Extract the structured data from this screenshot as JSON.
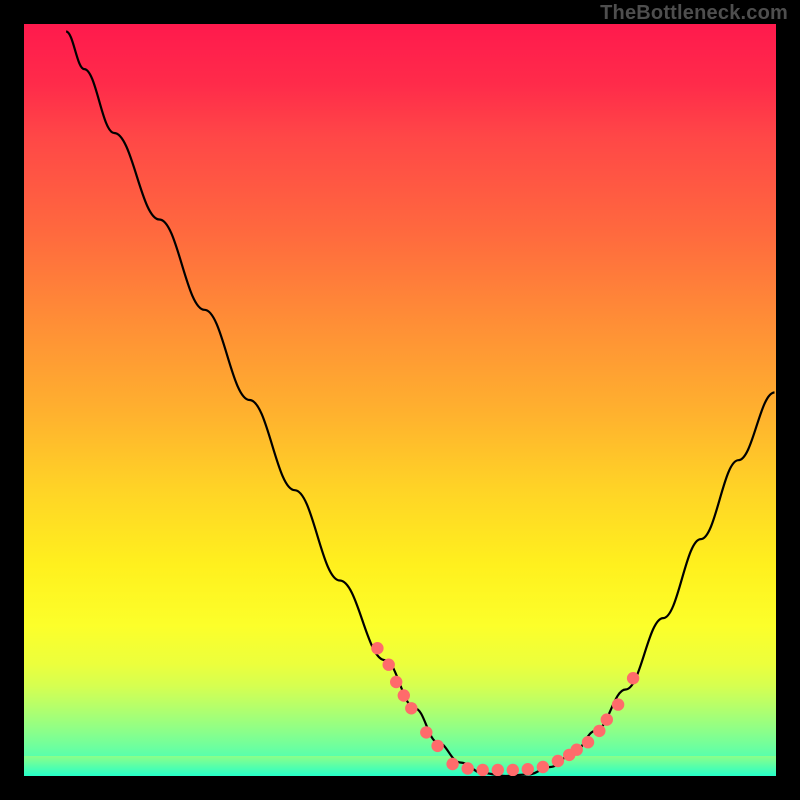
{
  "watermark": "TheBottleneck.com",
  "colors": {
    "dot": "#ff6b6b",
    "line": "#000000"
  },
  "chart_data": {
    "type": "line",
    "title": "",
    "xlabel": "",
    "ylabel": "",
    "xlim": [
      0,
      100
    ],
    "ylim": [
      0,
      100
    ],
    "curve": [
      {
        "x": 5.6,
        "y": 99.0
      },
      {
        "x": 8.0,
        "y": 94.0
      },
      {
        "x": 12.0,
        "y": 85.5
      },
      {
        "x": 18.0,
        "y": 74.0
      },
      {
        "x": 24.0,
        "y": 62.0
      },
      {
        "x": 30.0,
        "y": 50.0
      },
      {
        "x": 36.0,
        "y": 38.0
      },
      {
        "x": 42.0,
        "y": 26.0
      },
      {
        "x": 48.0,
        "y": 15.4
      },
      {
        "x": 52.0,
        "y": 9.0
      },
      {
        "x": 55.0,
        "y": 4.5
      },
      {
        "x": 58.0,
        "y": 1.8
      },
      {
        "x": 61.0,
        "y": 0.4
      },
      {
        "x": 64.0,
        "y": 0.0
      },
      {
        "x": 67.0,
        "y": 0.2
      },
      {
        "x": 70.0,
        "y": 1.2
      },
      {
        "x": 73.0,
        "y": 3.0
      },
      {
        "x": 76.0,
        "y": 6.0
      },
      {
        "x": 80.0,
        "y": 11.5
      },
      {
        "x": 85.0,
        "y": 21.0
      },
      {
        "x": 90.0,
        "y": 31.5
      },
      {
        "x": 95.0,
        "y": 42.0
      },
      {
        "x": 99.8,
        "y": 51.0
      }
    ],
    "dots": [
      {
        "x": 47.0,
        "y": 17.0
      },
      {
        "x": 48.5,
        "y": 14.8
      },
      {
        "x": 49.5,
        "y": 12.5
      },
      {
        "x": 50.5,
        "y": 10.7
      },
      {
        "x": 51.5,
        "y": 9.0
      },
      {
        "x": 53.5,
        "y": 5.8
      },
      {
        "x": 55.0,
        "y": 4.0
      },
      {
        "x": 57.0,
        "y": 1.6
      },
      {
        "x": 59.0,
        "y": 1.0
      },
      {
        "x": 61.0,
        "y": 0.8
      },
      {
        "x": 63.0,
        "y": 0.8
      },
      {
        "x": 65.0,
        "y": 0.8
      },
      {
        "x": 67.0,
        "y": 0.9
      },
      {
        "x": 69.0,
        "y": 1.2
      },
      {
        "x": 71.0,
        "y": 2.0
      },
      {
        "x": 72.5,
        "y": 2.8
      },
      {
        "x": 73.5,
        "y": 3.5
      },
      {
        "x": 75.0,
        "y": 4.5
      },
      {
        "x": 76.5,
        "y": 6.0
      },
      {
        "x": 77.5,
        "y": 7.5
      },
      {
        "x": 79.0,
        "y": 9.5
      },
      {
        "x": 81.0,
        "y": 13.0
      }
    ]
  }
}
